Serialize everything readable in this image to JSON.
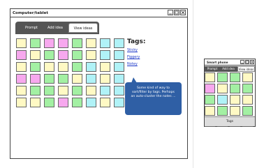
{
  "main_window": {
    "title": "Computer/tablet",
    "tabs": [
      {
        "label": "Prompt",
        "active": false
      },
      {
        "label": "Add idea",
        "active": false
      },
      {
        "label": "View ideas",
        "active": true
      }
    ],
    "tags_heading": "Tags:",
    "tags": [
      "Sticky",
      "Figgery",
      "Notey"
    ],
    "callout_text": "Some kind of way to sort/filter by tags.  Perhaps an auto-cluster the notes ..."
  },
  "phone_window": {
    "title": "Smart phone",
    "tabs": [
      {
        "label": "Prompt",
        "active": false
      },
      {
        "label": "Add idea",
        "active": false
      },
      {
        "label": "View ideas",
        "active": true
      }
    ],
    "footer_label": "Tags"
  },
  "colors": {
    "yellow": "#fff9c4",
    "green": "#a3f0a3",
    "pink": "#f7a8ee",
    "cyan": "#b0f2f7",
    "callout": "#2f5fa5",
    "link": "#1a36c8"
  },
  "main_notes": [
    [
      "yellow",
      "green",
      "pink",
      "pink",
      "green",
      "yellow",
      "cyan",
      "cyan"
    ],
    [
      "pink",
      "yellow",
      "green",
      "pink",
      "green",
      "yellow",
      "cyan",
      "cyan"
    ],
    [
      "yellow",
      "green",
      "yellow",
      "yellow",
      "green",
      "cyan",
      "yellow",
      "cyan"
    ],
    [
      "pink",
      "pink",
      "green",
      "green",
      "yellow",
      "cyan",
      "yellow",
      "cyan"
    ],
    [
      "yellow",
      "green",
      "green",
      "yellow",
      "green",
      "yellow",
      "cyan",
      "cyan"
    ],
    [
      "yellow",
      "yellow",
      "green",
      "pink",
      "green",
      "cyan",
      "yellow",
      "cyan"
    ]
  ],
  "phone_notes": [
    [
      "yellow",
      "green",
      "green",
      "yellow"
    ],
    [
      "pink",
      "yellow",
      "green",
      "green"
    ],
    [
      "green",
      "cyan",
      "yellow",
      "yellow"
    ],
    [
      "yellow",
      "green",
      "yellow",
      "green"
    ],
    [
      "pink",
      "yellow",
      "green",
      "green"
    ]
  ]
}
